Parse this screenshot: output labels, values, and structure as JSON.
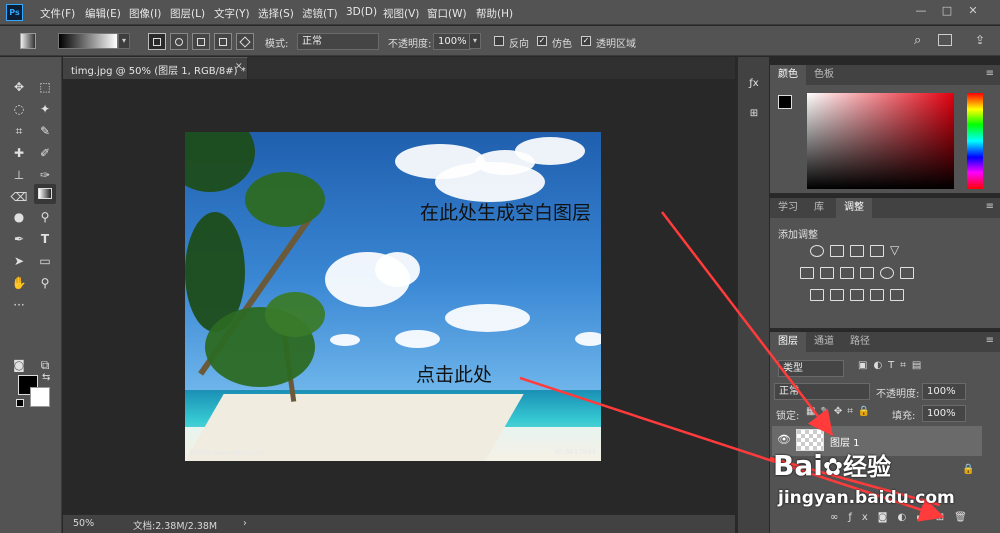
{
  "app": {
    "logo": "Ps"
  },
  "menu": [
    "文件(F)",
    "编辑(E)",
    "图像(I)",
    "图层(L)",
    "文字(Y)",
    "选择(S)",
    "滤镜(T)",
    "3D(D)",
    "视图(V)",
    "窗口(W)",
    "帮助(H)"
  ],
  "window_controls": {
    "minimize": "—",
    "maximize": "□",
    "close": "✕"
  },
  "options": {
    "mode_label": "模式:",
    "mode_value": "正常",
    "opacity_label": "不透明度:",
    "opacity_value": "100%",
    "reverse_label": "反向",
    "dither_label": "仿色",
    "transparency_label": "透明区域",
    "dither_checked": true,
    "transparency_checked": true
  },
  "document": {
    "tab_title": "timg.jpg @ 50% (图层 1, RGB/8#) *",
    "zoom": "50%",
    "doc_size": "文档:2.38M/2.38M",
    "watermark_left": "昵图网 www.nipic.com",
    "watermark_right": "ID:6617894"
  },
  "annotations": {
    "top": "在此处生成空白图层",
    "bottom": "点击此处"
  },
  "colors_panel": {
    "tabs": [
      "颜色",
      "色板"
    ],
    "accent_hue": "#e3000f"
  },
  "adjust_panel": {
    "tabs": [
      "学习",
      "库",
      "调整"
    ],
    "add_label": "添加调整"
  },
  "layers_panel": {
    "tabs": [
      "图层",
      "通道",
      "路径"
    ],
    "filter_label": "类型",
    "blend_mode": "正常",
    "opacity_label": "不透明度:",
    "opacity_value": "100%",
    "lock_label": "锁定:",
    "fill_label": "填充:",
    "fill_value": "100%",
    "layer1_name": "图层 1"
  },
  "watermark": {
    "brand": "Bai",
    "brand2": "经验",
    "url": "jingyan.baidu.com"
  }
}
